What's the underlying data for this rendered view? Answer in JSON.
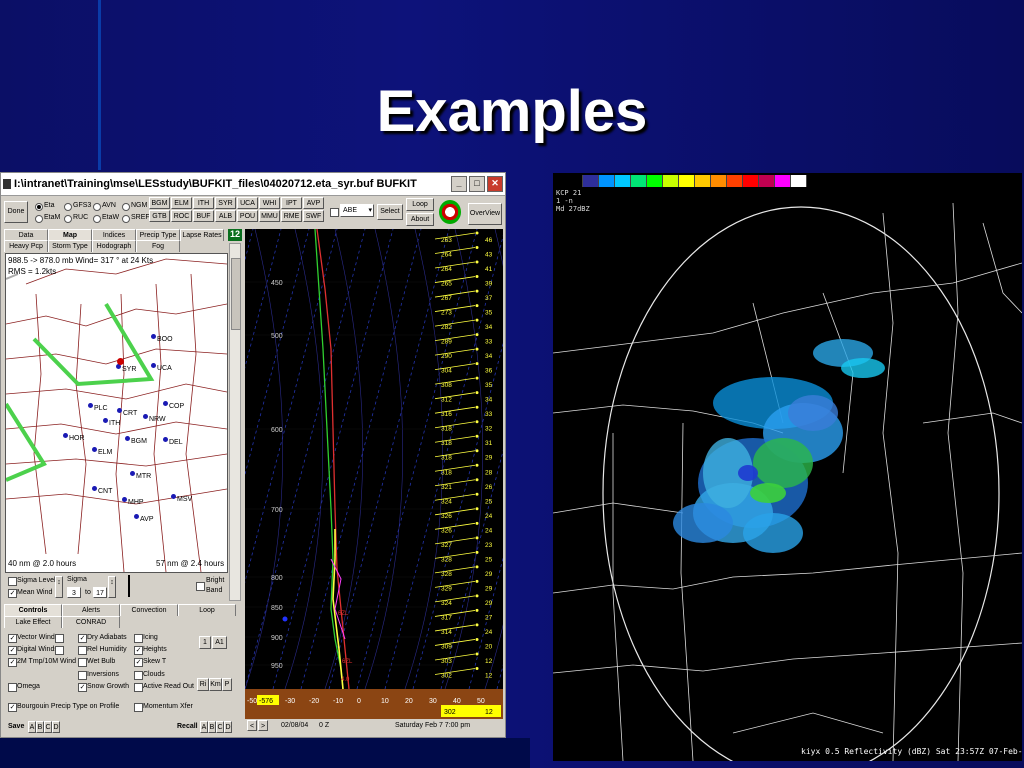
{
  "slide": {
    "title": "Examples"
  },
  "app": {
    "window_title": "I:\\intranet\\Training\\mse\\LESstudy\\BUFKIT_files\\04020712.eta_syr.buf BUFKIT",
    "done_label": "Done",
    "models": [
      "Eta",
      "GFS3",
      "AVN",
      "NGM",
      "EtaM",
      "RUC",
      "EtaW",
      "SREF"
    ],
    "selected_model": "Eta",
    "stations": [
      "BGM",
      "ELM",
      "ITH",
      "SYR",
      "UCA",
      "WHI",
      "IPT",
      "AVP",
      "GTB",
      "ROC",
      "BUF",
      "ALB",
      "POU",
      "MMU",
      "RME",
      "SWF"
    ],
    "station_select": "ABE",
    "select_label": "Select",
    "loop_label": "Loop",
    "about_label": "About",
    "overview_label": "OverView",
    "hour_badge": "12",
    "tabs_row1": [
      "Data",
      "Map",
      "Indices",
      "Precip Type",
      "Lapse Rates"
    ],
    "tabs_row2": [
      "Heavy Pcp",
      "Storm Type",
      "Hodograph",
      "Fog"
    ],
    "active_tab": "Map",
    "map_info1": "988.5 -> 878.0 mb Wind=  317 ° at 24 Kts",
    "map_info2": "RMS = 1.2kts",
    "map_stations": [
      "BOO",
      "UCA",
      "SYR",
      "COP",
      "PLC",
      "CRT",
      "NRW",
      "ITH",
      "HOR",
      "BGM",
      "DEL",
      "ELM",
      "MTR",
      "CNT",
      "MHP",
      "MSV",
      "AVP"
    ],
    "map_bottom_left": "40 nm  @ 2.0 hours",
    "map_bottom_right": "57 nm  @ 2.4 hours",
    "sigma_level": "Sigma Level",
    "mean_wind": "Mean Wind",
    "sigma_label": "Sigma",
    "sigma_from": "3",
    "sigma_to_label": "to",
    "sigma_to": "17",
    "bright_label": "Bright",
    "band_label": "Band",
    "ctrl_tabs": [
      "Controls",
      "Alerts",
      "Convection",
      "Loop",
      "Lake Effect",
      "CONRAD"
    ],
    "options_col1": [
      "Vector Winds",
      "Digital Winds",
      "2M Tmp/10M Wind",
      "Omega",
      "Bourgouin  Precip Type on Profile"
    ],
    "options_col2": [
      "Dry Adiabats",
      "Rel Humidity",
      "Wet Bulb",
      "Inversions",
      "Snow Growth"
    ],
    "options_col3": [
      "Icing",
      "Heights",
      "Skew T",
      "Clouds",
      "Active Read Out",
      "Momentum Xfer"
    ],
    "btn_1": "1",
    "btn_a1": "A1",
    "btn_ri": "Ri",
    "btn_km": "Km",
    "btn_p": "P",
    "save_label": "Save",
    "recall_label": "Recall",
    "slots": [
      "A",
      "B",
      "C",
      "D"
    ],
    "skewt_pressures": [
      "450",
      "500",
      "600",
      "700",
      "800",
      "850",
      "900",
      "950"
    ],
    "skewt_temps": [
      "-50",
      "-30",
      "-20",
      "-10",
      "0",
      "10",
      "20",
      "30",
      "40",
      "50"
    ],
    "skewt_low_temp": "-576",
    "skewt_wind_labels": [
      "263",
      "46",
      "264",
      "43",
      "264",
      "41",
      "265",
      "39",
      "267",
      "37",
      "273",
      "35",
      "282",
      "34",
      "289",
      "33",
      "290",
      "34",
      "304",
      "36",
      "308",
      "35",
      "312",
      "34",
      "316",
      "33",
      "318",
      "32",
      "318",
      "31",
      "318",
      "29",
      "318",
      "28",
      "321",
      "26",
      "324",
      "25",
      "326",
      "24",
      "326",
      "24",
      "327",
      "23",
      "328",
      "25",
      "328",
      "29",
      "329",
      "29",
      "324",
      "29",
      "317",
      "27",
      "314",
      "24",
      "309",
      "20",
      "303",
      "12",
      "302",
      "12"
    ],
    "skewt_sfc1": "302",
    "skewt_sfc2": "12",
    "skewt_date": "02/08/04",
    "skewt_z": "0 Z",
    "skewt_valid": "Saturday  Feb 7  7:00 pm",
    "skewt_mark1": "6ZL",
    "skewt_mark2": "6ZL",
    "skewt_mark3": "4.0"
  },
  "radar": {
    "header1": "KCP  21",
    "header2": "1 -n",
    "header3": "Md  27dBZ",
    "footer": "kiyx 0.5 Reflectivity (dBZ)  Sat 23:57Z 07-Feb-04",
    "legend_colors": [
      "#000000",
      "#2e2e9a",
      "#0094ff",
      "#00c8ff",
      "#00e676",
      "#00ff00",
      "#c8ff00",
      "#ffff00",
      "#ffc800",
      "#ff8c00",
      "#ff4000",
      "#ff0000",
      "#c00050",
      "#ff00ff",
      "#ffffff"
    ]
  }
}
